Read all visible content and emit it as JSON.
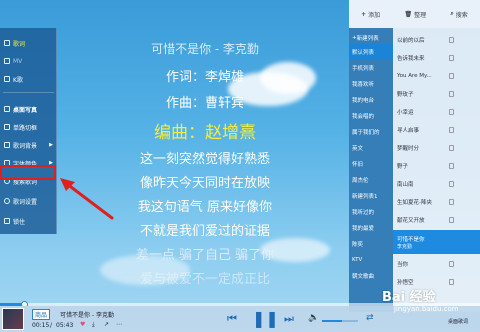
{
  "left_menu": {
    "items": [
      {
        "label": "歌词",
        "icon": "lyrics-icon",
        "checked": true
      },
      {
        "label": "MV",
        "icon": "mv-icon"
      },
      {
        "label": "K歌",
        "icon": "karaoke-icon"
      },
      {
        "label": "桌面写真",
        "icon": "desktop-photo-icon"
      },
      {
        "label": "单路切框",
        "icon": "frame-icon"
      },
      {
        "label": "歌词背景",
        "icon": "background-icon",
        "submenu": true
      },
      {
        "label": "字体颜色",
        "icon": "font-color-icon",
        "submenu": true
      },
      {
        "label": "搜索歌词",
        "icon": "search-icon"
      },
      {
        "label": "歌词设置",
        "icon": "gear-icon"
      },
      {
        "label": "锁住",
        "icon": "lock-icon"
      }
    ]
  },
  "lyrics": {
    "lines": [
      {
        "text": "可惜不是你 - 李克勤",
        "color": "#d9ecfa"
      },
      {
        "text": "作词：李焯雄",
        "color": "#ffffff"
      },
      {
        "text": "作曲：曹轩宾",
        "color": "#ffffff"
      },
      {
        "text": "编曲：赵增熹",
        "color": "#f5ee3a"
      },
      {
        "text": "这一刻突然觉得好熟悉",
        "color": "#ffffff"
      },
      {
        "text": "像昨天今天同时在放映",
        "color": "#ffffff"
      },
      {
        "text": "我这句语气 原来好像你",
        "color": "#ffffff"
      },
      {
        "text": "不就是我们爱过的证据",
        "color": "#ffffff"
      },
      {
        "text": "差一点 骗了自己 骗了你",
        "color": "#e6f1fa"
      },
      {
        "text": "爱与被爱不一定成正比",
        "color": "#eef6fc"
      }
    ]
  },
  "right_panel": {
    "toolbar": {
      "add": "添加",
      "manage": "整理",
      "search": "搜索"
    },
    "new_list_label": "新建列表",
    "playlists": [
      "默认列表",
      "手机列表",
      "我喜欢听",
      "我的电台",
      "我会唱的",
      "属于我们的",
      "英文",
      "怀旧",
      "周杰伦",
      "新建列表1",
      "我听过的",
      "我的最爱",
      "陈奕",
      "KTV",
      "朝文歌曲"
    ],
    "songs": [
      "以前的以后",
      "告诉我未来",
      "You Are My...",
      "野玫子",
      "小幸运",
      "寻人启事",
      "梦醒时分",
      "野子",
      "南山南",
      "生如夏花-降央",
      "献花又开放",
      "可惜不是你",
      "当你",
      "孙悟空"
    ],
    "playing": {
      "title": "可惜不是你",
      "artist": "李克勤"
    }
  },
  "player": {
    "source": "商品",
    "now_playing": "可惜不是你 - 李克勤",
    "elapsed": "00:15",
    "total": "05:43",
    "progress": 0.05,
    "volume": 0.55,
    "mode_label": "桌面歌词"
  },
  "watermark": {
    "text": "Bai 经验",
    "url": "jingyan.baidu.com"
  },
  "colors": {
    "accent": "#1e8be0",
    "highlight_box": "#e0201c",
    "lyric_active": "#f5ee3a"
  }
}
